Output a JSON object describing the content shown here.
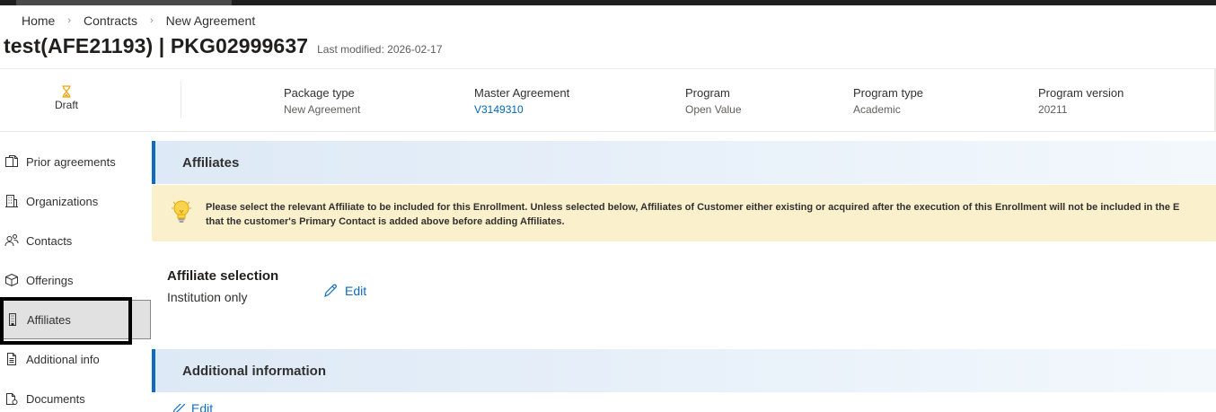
{
  "breadcrumb": {
    "items": [
      "Home",
      "Contracts",
      "New Agreement"
    ]
  },
  "header": {
    "title": "test(AFE21193) | PKG02999637",
    "last_modified": "Last modified: 2026-02-17"
  },
  "status": {
    "label": "Draft",
    "icon": "hourglass-icon",
    "color": "#f2a100"
  },
  "meta": [
    {
      "label": "Package type",
      "value": "New Agreement"
    },
    {
      "label": "Master Agreement",
      "value": "V3149310"
    },
    {
      "label": "Program",
      "value": "Open Value"
    },
    {
      "label": "Program type",
      "value": "Academic"
    },
    {
      "label": "Program version",
      "value": "20211"
    }
  ],
  "sidebar": {
    "items": [
      {
        "label": "Prior agreements",
        "icon": "documents-copy-icon"
      },
      {
        "label": "Organizations",
        "icon": "building-icon"
      },
      {
        "label": "Contacts",
        "icon": "people-icon"
      },
      {
        "label": "Offerings",
        "icon": "box-icon"
      },
      {
        "label": "Affiliates",
        "icon": "building-small-icon",
        "active": true
      },
      {
        "label": "Additional info",
        "icon": "document-text-icon"
      },
      {
        "label": "Documents",
        "icon": "document-stack-icon"
      }
    ]
  },
  "sections": {
    "affiliates": {
      "title": "Affiliates",
      "notice_line1": "Please select the relevant Affiliate to be included for this Enrollment. Unless selected below, Affiliates of Customer either existing or acquired after the execution of this Enrollment will not be included in the E",
      "notice_line2": "that the customer's Primary Contact is added above before adding Affiliates.",
      "selection_title": "Affiliate selection",
      "selection_value": "Institution only",
      "edit_label": "Edit"
    },
    "additional_information": {
      "title": "Additional information",
      "edit_label": "Edit"
    }
  },
  "colors": {
    "accent": "#0f6cbd",
    "link": "#0067b8",
    "notice_bg": "#faf0cc",
    "header_bg": "#dde9f6"
  }
}
